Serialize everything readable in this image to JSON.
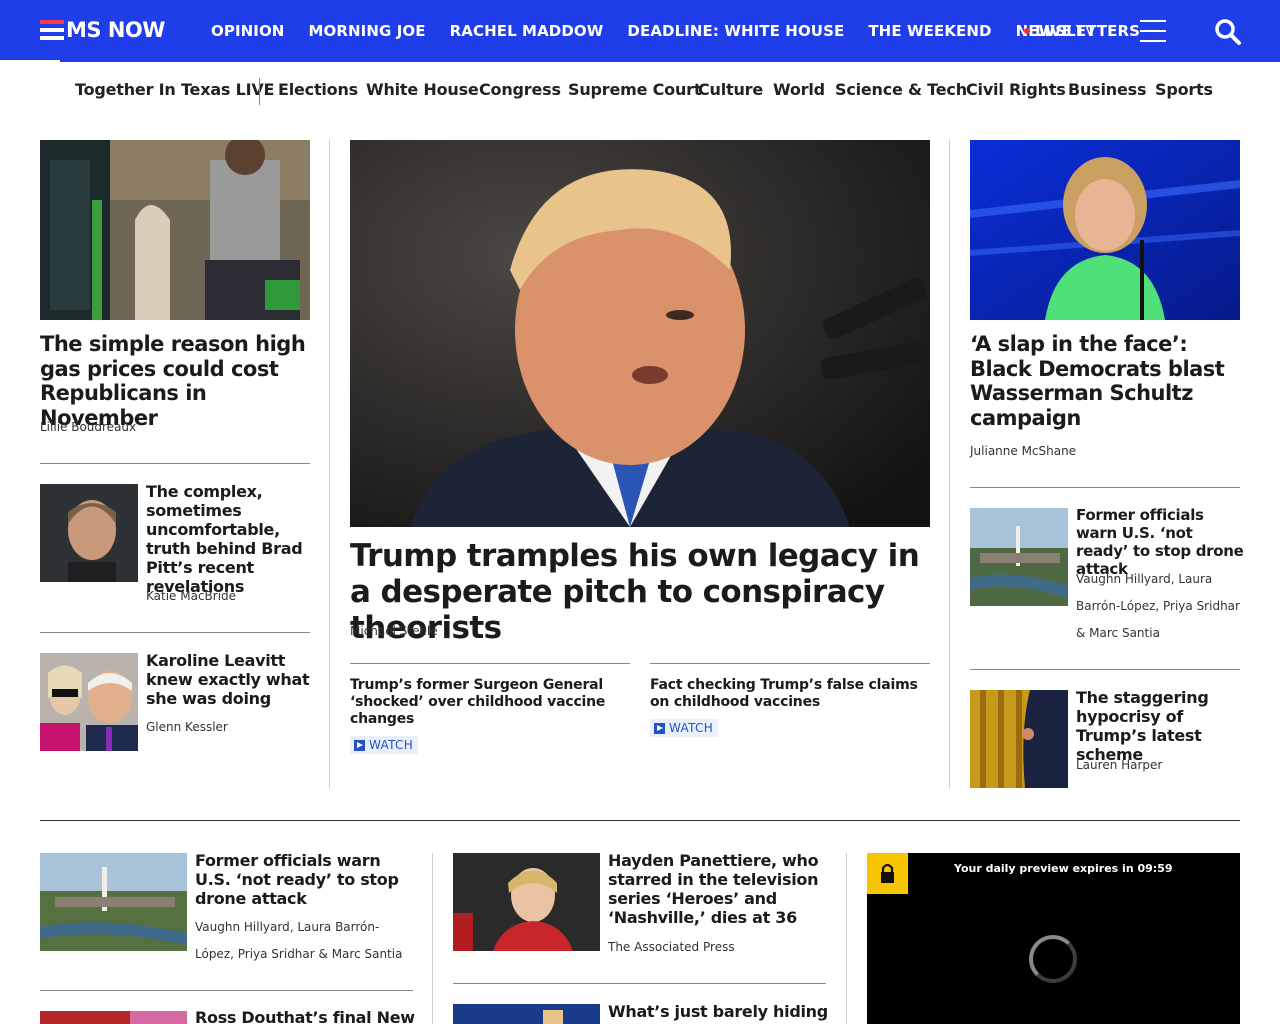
{
  "brand": {
    "name": "MS NOW"
  },
  "colors": {
    "nav_bg": "#1f3eea",
    "live_dot": "#ff2b2b",
    "watch_text": "#2450c9",
    "lock_badge": "#f7c600"
  },
  "nav": {
    "items": [
      "OPINION",
      "MORNING JOE",
      "RACHEL MADDOW",
      "DEADLINE: WHITE HOUSE",
      "THE WEEKEND",
      "NEWSLETTERS"
    ],
    "live_label": "LIVE",
    "live_suffix": "TV",
    "menu_icon": "hamburger-icon",
    "search_icon": "search-icon"
  },
  "subnav": {
    "featured": "Together In Texas LIVE",
    "items": [
      "Elections",
      "White House",
      "Congress",
      "Supreme Court",
      "Culture",
      "World",
      "Science & Tech",
      "Civil Rights",
      "Business",
      "Sports"
    ]
  },
  "left_col": {
    "lead": {
      "headline": "The simple reason high gas prices could cost Republicans in November",
      "byline": "Lillie Boudreaux"
    },
    "stories": [
      {
        "headline": "The complex, sometimes uncomfortable, truth behind Brad Pitt’s recent revelations",
        "byline": "Katie MacBride"
      },
      {
        "headline": "Karoline Leavitt knew exactly what she was doing",
        "byline": "Glenn Kessler"
      }
    ]
  },
  "center_col": {
    "lead": {
      "headline": "Trump tramples his own legacy in a desperate pitch to conspiracy theorists",
      "byline": "Michael Steele"
    },
    "related": [
      {
        "headline": "Trump’s former Surgeon General ‘shocked’ over childhood vaccine changes",
        "tag": "WATCH"
      },
      {
        "headline": "Fact checking Trump’s false claims on childhood vaccines",
        "tag": "WATCH"
      }
    ]
  },
  "right_col": {
    "lead": {
      "headline": "‘A slap in the face’: Black Democrats blast Wasserman Schultz campaign",
      "byline": "Julianne McShane"
    },
    "stories": [
      {
        "headline": "Former officials warn U.S. ‘not ready’ to stop drone attack",
        "byline": "Vaughn Hillyard, Laura Barrón-López, Priya Sridhar & Marc Santia"
      },
      {
        "headline": "The staggering hypocrisy of Trump’s latest scheme",
        "byline": "Lauren Harper"
      }
    ]
  },
  "lower": {
    "col1": [
      {
        "headline": "Former officials warn U.S. ‘not ready’ to stop drone attack",
        "byline": "Vaughn Hillyard, Laura Barrón-López, Priya Sridhar & Marc Santia"
      },
      {
        "headline": "Ross Douthat’s final New"
      }
    ],
    "col2": [
      {
        "headline": "Hayden Panettiere, who starred in the television series ‘Heroes’ and ‘Nashville,’ dies at 36",
        "byline": "The Associated Press"
      },
      {
        "headline": "What’s just barely hiding"
      }
    ],
    "player": {
      "preview_text": "Your daily preview expires in 09:59"
    }
  }
}
